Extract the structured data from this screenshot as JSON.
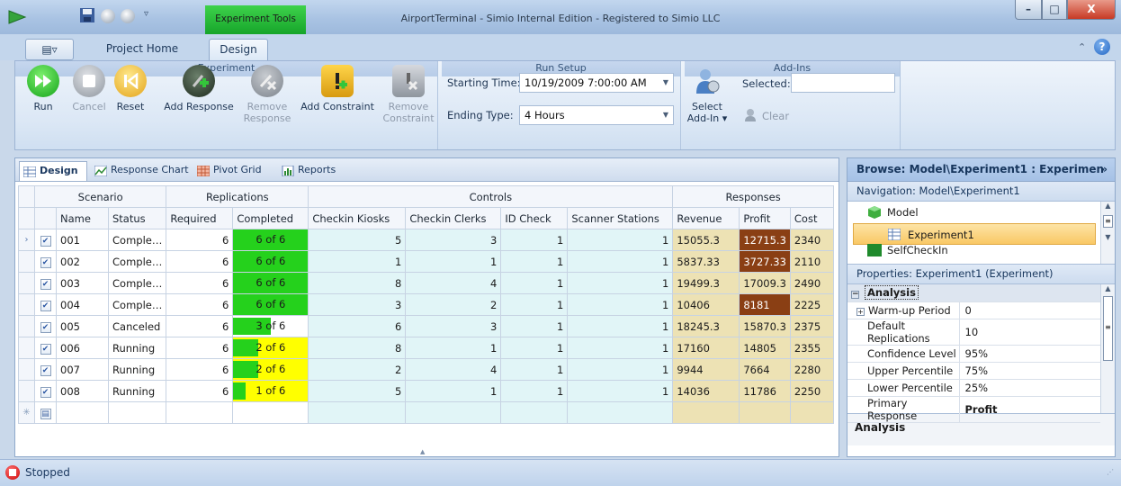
{
  "app": {
    "window_title": "AirportTerminal - Simio Internal Edition - Registered to Simio LLC",
    "contextual_tab": "Experiment Tools",
    "window_buttons": {
      "minimize": "–",
      "maximize": "□",
      "close": "X"
    }
  },
  "ribbon_tabs": {
    "menu": "▤▿",
    "project_home": "Project Home",
    "design": "Design"
  },
  "ribbon": {
    "experiment_group": {
      "label": "Experiment",
      "run": "Run",
      "cancel": "Cancel",
      "reset": "Reset",
      "add_response": "Add Response",
      "remove_response_1": "Remove",
      "remove_response_2": "Response",
      "add_constraint": "Add Constraint",
      "remove_constraint_1": "Remove",
      "remove_constraint_2": "Constraint"
    },
    "run_setup_group": {
      "label": "Run Setup",
      "starting_time_label": "Starting Time:",
      "starting_time_value": "10/19/2009 7:00:00 AM",
      "ending_type_label": "Ending Type:",
      "ending_type_value": "4 Hours"
    },
    "addins_group": {
      "label": "Add-Ins",
      "select_1": "Select",
      "select_2": "Add-In ▾",
      "selected_label": "Selected:",
      "selected_value": "",
      "clear": "Clear"
    }
  },
  "subtabs": {
    "design": "Design",
    "response_chart": "Response Chart",
    "pivot_grid": "Pivot Grid",
    "reports": "Reports"
  },
  "grid": {
    "groups": {
      "scenario": "Scenario",
      "replications": "Replications",
      "controls": "Controls",
      "responses": "Responses"
    },
    "columns": {
      "name": "Name",
      "status": "Status",
      "required": "Required",
      "completed": "Completed",
      "checkin_kiosks": "Checkin Kiosks",
      "checkin_clerks": "Checkin Clerks",
      "id_check": "ID Check",
      "scanner_stations": "Scanner Stations",
      "revenue": "Revenue",
      "profit": "Profit",
      "cost": "Cost"
    },
    "rows": [
      {
        "name": "001",
        "status": "Comple…",
        "required": "6",
        "completed": "6 of 6",
        "done": 6,
        "total": 6,
        "kiosks": "5",
        "clerks": "3",
        "id": "1",
        "scanners": "1",
        "revenue": "15055.3",
        "profit": "12715.3",
        "cost": "2340"
      },
      {
        "name": "002",
        "status": "Comple…",
        "required": "6",
        "completed": "6 of 6",
        "done": 6,
        "total": 6,
        "kiosks": "1",
        "clerks": "1",
        "id": "1",
        "scanners": "1",
        "revenue": "5837.33",
        "profit": "3727.33",
        "cost": "2110"
      },
      {
        "name": "003",
        "status": "Comple…",
        "required": "6",
        "completed": "6 of 6",
        "done": 6,
        "total": 6,
        "kiosks": "8",
        "clerks": "4",
        "id": "1",
        "scanners": "1",
        "revenue": "19499.3",
        "profit": "17009.3",
        "cost": "2490"
      },
      {
        "name": "004",
        "status": "Comple…",
        "required": "6",
        "completed": "6 of 6",
        "done": 6,
        "total": 6,
        "kiosks": "3",
        "clerks": "2",
        "id": "1",
        "scanners": "1",
        "revenue": "10406",
        "profit": "8181",
        "cost": "2225"
      },
      {
        "name": "005",
        "status": "Canceled",
        "required": "6",
        "completed": "3 of 6",
        "done": 3,
        "total": 6,
        "kiosks": "6",
        "clerks": "3",
        "id": "1",
        "scanners": "1",
        "revenue": "18245.3",
        "profit": "15870.3",
        "cost": "2375"
      },
      {
        "name": "006",
        "status": "Running",
        "required": "6",
        "completed": "2 of 6",
        "done": 2,
        "total": 6,
        "kiosks": "8",
        "clerks": "1",
        "id": "1",
        "scanners": "1",
        "revenue": "17160",
        "profit": "14805",
        "cost": "2355"
      },
      {
        "name": "007",
        "status": "Running",
        "required": "6",
        "completed": "2 of 6",
        "done": 2,
        "total": 6,
        "kiosks": "2",
        "clerks": "4",
        "id": "1",
        "scanners": "1",
        "revenue": "9944",
        "profit": "7664",
        "cost": "2280"
      },
      {
        "name": "008",
        "status": "Running",
        "required": "6",
        "completed": "1 of 6",
        "done": 1,
        "total": 6,
        "kiosks": "5",
        "clerks": "1",
        "id": "1",
        "scanners": "1",
        "revenue": "14036",
        "profit": "11786",
        "cost": "2250"
      }
    ]
  },
  "right_panel": {
    "browse_title": "Browse: Model\\Experiment1 : Experimen",
    "navigation_title": "Navigation: Model\\Experiment1",
    "nav_items": {
      "model": "Model",
      "experiment1": "Experiment1",
      "selfcheckin": "SelfCheckIn"
    },
    "properties_title": "Properties: Experiment1 (Experiment)",
    "category": "Analysis",
    "properties": [
      {
        "name": "Warm-up Period",
        "value": "0"
      },
      {
        "name": "Default Replications",
        "value": "10"
      },
      {
        "name": "Confidence Level",
        "value": "95%"
      },
      {
        "name": "Upper Percentile",
        "value": "75%"
      },
      {
        "name": "Lower Percentile",
        "value": "25%"
      },
      {
        "name": "Primary Response",
        "value": "Profit"
      }
    ],
    "description_title": "Analysis"
  },
  "status": {
    "text": "Stopped"
  },
  "colors": {
    "accent_green": "#25d11c",
    "partial_yellow": "#ffff00",
    "profit_highlight": "#8a3f14",
    "controls_bg": "#e1f5f7",
    "responses_bg": "#ede2b4"
  }
}
